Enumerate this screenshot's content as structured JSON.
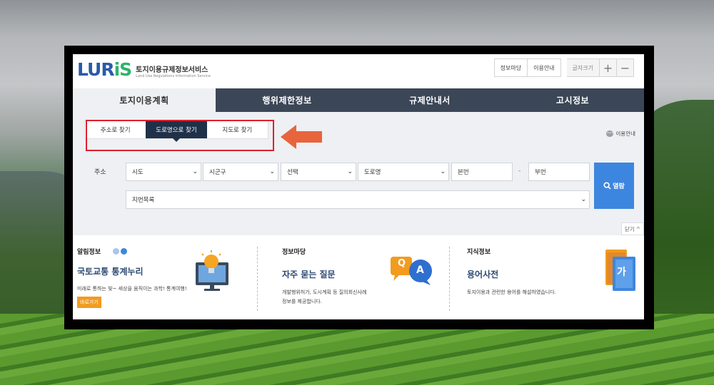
{
  "header": {
    "logo_mark_main": "LUR",
    "logo_mark_accent": "iS",
    "logo_kor": "토지이용규제정보서비스",
    "logo_eng": "Land Use Regulations Information Service",
    "links": [
      "정보마당",
      "이용안내"
    ],
    "font_size_label": "글자크기",
    "increase_label": "+",
    "decrease_label": "−"
  },
  "nav": {
    "tabs": [
      "토지이용계획",
      "행위제한정보",
      "규제안내서",
      "고시정보"
    ],
    "active_index": 0
  },
  "search": {
    "subtabs": [
      "주소로 찾기",
      "도로명으로 찾기",
      "지도로 찾기"
    ],
    "active_subtab": 1,
    "help_label": "이용안내",
    "address_label": "주소",
    "sido": "시도",
    "sigungu": "시군구",
    "select": "선택",
    "road_name": "도로명",
    "main_number": "본번",
    "dash": "-",
    "sub_number": "부번",
    "lot_list": "지번목록",
    "search_button": "열람",
    "close_label": "닫기"
  },
  "cards": {
    "notice": {
      "title": "알림정보",
      "headline": "국토교통 통계누리",
      "desc": "미래로 통하는 빛~ 세상을 움직이는 과학! 통계여행!",
      "button": "바로가기"
    },
    "info": {
      "title": "정보마당",
      "headline": "자주 묻는 질문",
      "desc_line1": "개발행위허가, 도시계획 등 질의회신사례",
      "desc_line2": "정보를 제공합니다.",
      "bubble_q": "Q",
      "bubble_a": "A"
    },
    "knowledge": {
      "title": "지식정보",
      "headline": "용어사전",
      "desc": "토지이용과 관련한 용어를 해설하였습니다.",
      "book_char": "가"
    }
  },
  "colors": {
    "nav_bg": "#3b4657",
    "subtab_active": "#1f3149",
    "search_button": "#3d86e0",
    "highlight_red": "#e0202e",
    "arrow": "#e8643c",
    "shortcut": "#f29b1f",
    "logo_blue": "#2a5aa8",
    "logo_green": "#2fb36b"
  }
}
